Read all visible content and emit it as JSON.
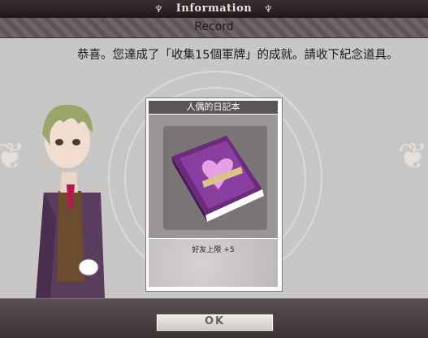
{
  "header": {
    "title": "Information",
    "subtitle": "Record"
  },
  "message": "恭喜。您達成了「收集15個軍牌」的成就。請收下紀念道具。",
  "reward": {
    "name": "人偶的日記本",
    "description": "好友上限 +5",
    "icon": "purple-book-heart-icon"
  },
  "footer": {
    "ok_label": "OK"
  }
}
